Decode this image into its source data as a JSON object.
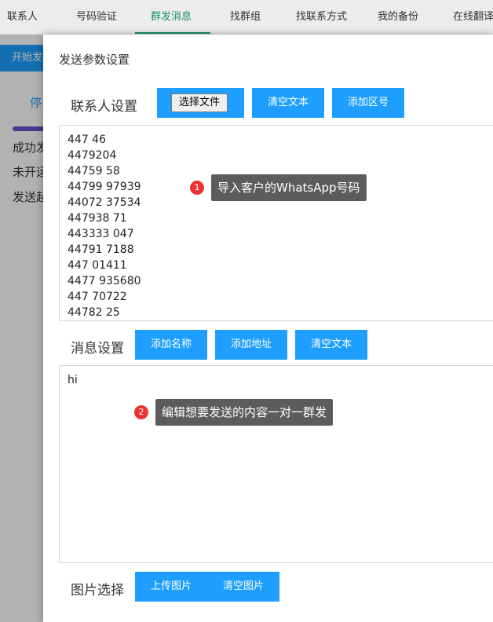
{
  "nav": {
    "items": [
      "联系人",
      "号码验证",
      "群发消息",
      "找群组",
      "找联系方式",
      "我的备份",
      "在线翻译"
    ],
    "active_index": 2
  },
  "background": {
    "start_button": "开始发",
    "tab": "停",
    "lines": [
      "成功发",
      "未开运",
      "发送起"
    ]
  },
  "dialog": {
    "title": "发送参数设置",
    "contacts": {
      "label": "联系人设置",
      "choose_file": "选择文件",
      "clear_text": "清空文本",
      "add_area_code": "添加区号",
      "phones": [
        "447          46",
        "4479204",
        "44759       58",
        "44799    97939",
        "44072     37534",
        "447938        71",
        "443333       047",
        "44791        7188",
        "447        01411",
        "4477       935680",
        "447          70722",
        "44782           25"
      ]
    },
    "message": {
      "label": "消息设置",
      "add_name": "添加名称",
      "add_address": "添加地址",
      "clear_text": "清空文本",
      "content": "hi"
    },
    "image": {
      "label": "图片选择",
      "upload": "上传图片",
      "clear": "清空图片"
    }
  },
  "callouts": [
    {
      "num": "1",
      "text": "导入客户的WhatsApp号码"
    },
    {
      "num": "2",
      "text": "编辑想要发送的内容一对一群发"
    }
  ],
  "colors": {
    "accent": "#1e9fff",
    "nav_active": "#1a8f6a",
    "badge": "#ee3333",
    "tooltip": "#5c5c5c"
  }
}
